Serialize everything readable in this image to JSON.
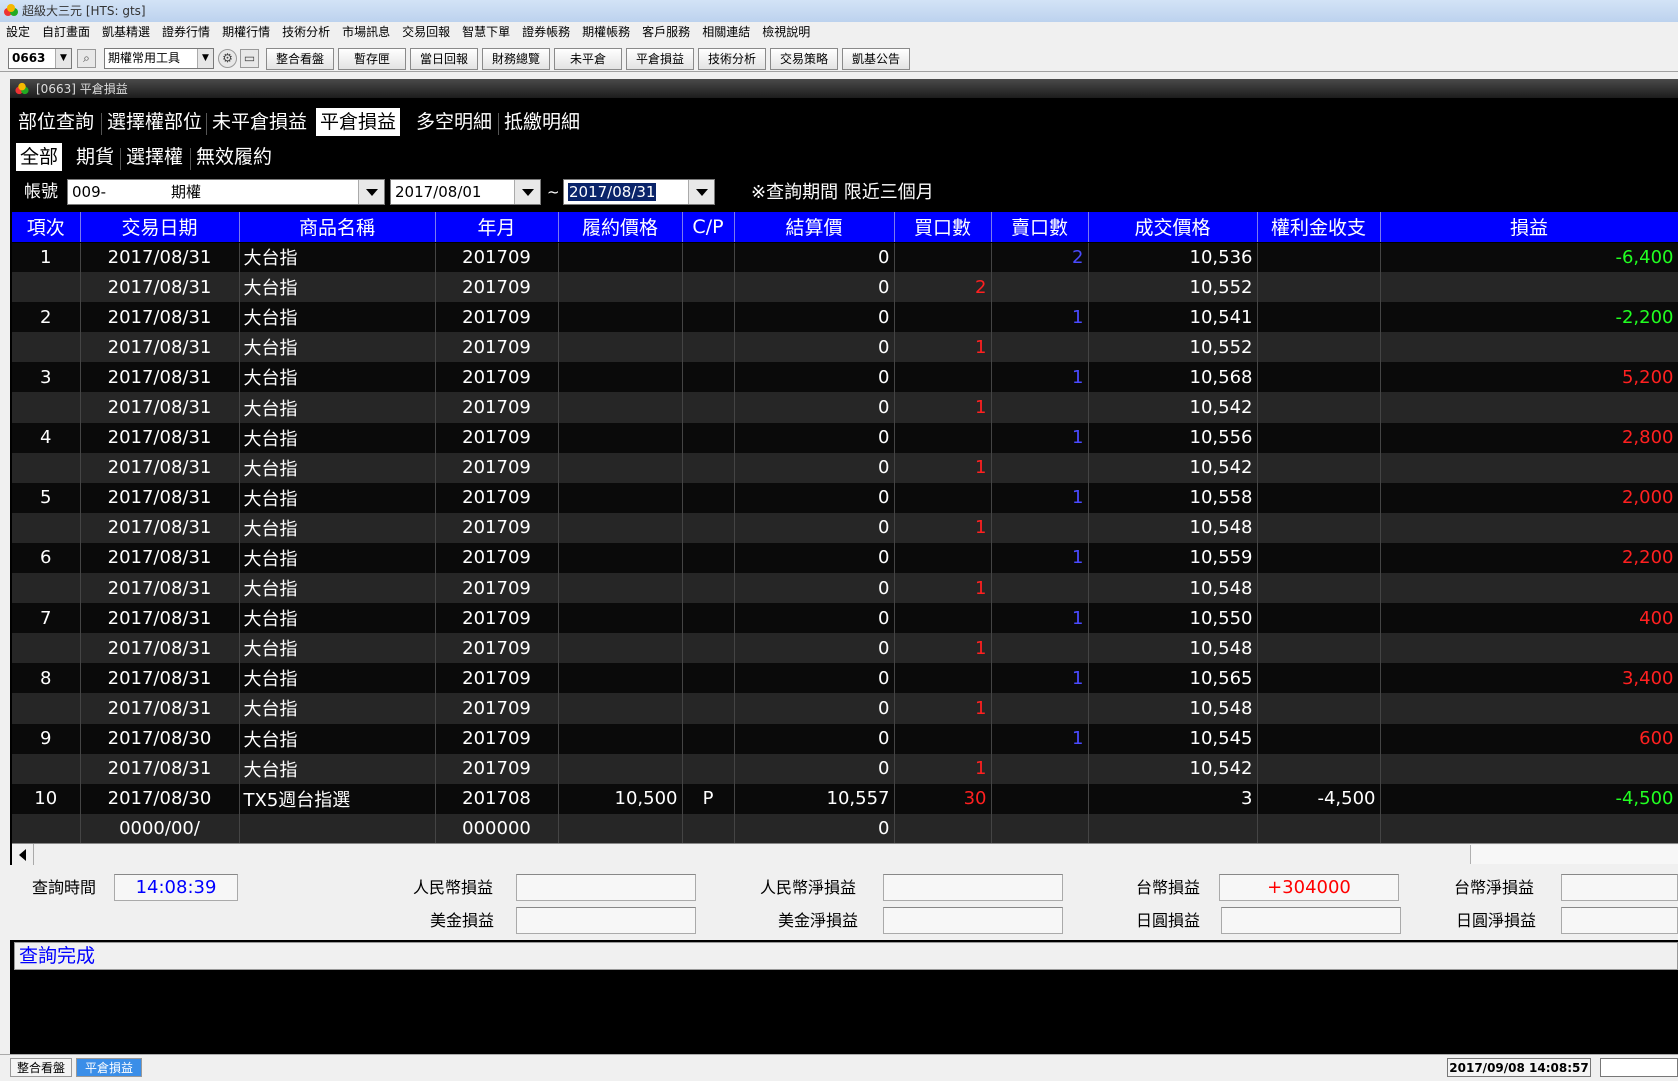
{
  "window": {
    "title": "超級大三元 [HTS: gts]"
  },
  "menu": [
    "設定",
    "自訂畫面",
    "凱基精選",
    "證券行情",
    "期權行情",
    "技術分析",
    "市場訊息",
    "交易回報",
    "智慧下單",
    "證券帳務",
    "期權帳務",
    "客戶服務",
    "相關連結",
    "檢視說明"
  ],
  "toolbar": {
    "code_value": "0663",
    "tool_select": "期權常用工具",
    "buttons": [
      "整合看盤",
      "暫存匣",
      "當日回報",
      "財務總覽",
      "未平倉",
      "平倉損益",
      "技術分析",
      "交易策略",
      "凱基公告"
    ]
  },
  "subwindow": {
    "title": "[0663] 平倉損益"
  },
  "tabs": [
    "部位查詢",
    "選擇權部位",
    "未平倉損益",
    "平倉損益",
    "多空明細",
    "抵繳明細"
  ],
  "subtabs": [
    "全部",
    "期貨",
    "選擇權",
    "無效履約"
  ],
  "filters": {
    "account_label": "帳號",
    "account_value": "009-",
    "account_name": "期權",
    "date_from": "2017/08/01",
    "tilde": "~",
    "date_to": "2017/08/31",
    "note": "※查詢期間 限近三個月"
  },
  "table": {
    "headers": [
      "項次",
      "交易日期",
      "商品名稱",
      "年月",
      "履約價格",
      "C/P",
      "結算價",
      "買口數",
      "賣口數",
      "成交價格",
      "權利金收支",
      "損益"
    ],
    "rows": [
      {
        "no": "1",
        "date": "2017/08/31",
        "name": "大台指",
        "ym": "201709",
        "strike": "",
        "cp": "",
        "settle": "0",
        "buy": "",
        "sell": "2",
        "price": "10,536",
        "premium": "",
        "pl": "-6,400",
        "plc": "green"
      },
      {
        "no": "",
        "date": "2017/08/31",
        "name": "大台指",
        "ym": "201709",
        "strike": "",
        "cp": "",
        "settle": "0",
        "buy": "2",
        "sell": "",
        "price": "10,552",
        "premium": "",
        "pl": "",
        "plc": ""
      },
      {
        "no": "2",
        "date": "2017/08/31",
        "name": "大台指",
        "ym": "201709",
        "strike": "",
        "cp": "",
        "settle": "0",
        "buy": "",
        "sell": "1",
        "price": "10,541",
        "premium": "",
        "pl": "-2,200",
        "plc": "green"
      },
      {
        "no": "",
        "date": "2017/08/31",
        "name": "大台指",
        "ym": "201709",
        "strike": "",
        "cp": "",
        "settle": "0",
        "buy": "1",
        "sell": "",
        "price": "10,552",
        "premium": "",
        "pl": "",
        "plc": ""
      },
      {
        "no": "3",
        "date": "2017/08/31",
        "name": "大台指",
        "ym": "201709",
        "strike": "",
        "cp": "",
        "settle": "0",
        "buy": "",
        "sell": "1",
        "price": "10,568",
        "premium": "",
        "pl": "5,200",
        "plc": "red"
      },
      {
        "no": "",
        "date": "2017/08/31",
        "name": "大台指",
        "ym": "201709",
        "strike": "",
        "cp": "",
        "settle": "0",
        "buy": "1",
        "sell": "",
        "price": "10,542",
        "premium": "",
        "pl": "",
        "plc": ""
      },
      {
        "no": "4",
        "date": "2017/08/31",
        "name": "大台指",
        "ym": "201709",
        "strike": "",
        "cp": "",
        "settle": "0",
        "buy": "",
        "sell": "1",
        "price": "10,556",
        "premium": "",
        "pl": "2,800",
        "plc": "red"
      },
      {
        "no": "",
        "date": "2017/08/31",
        "name": "大台指",
        "ym": "201709",
        "strike": "",
        "cp": "",
        "settle": "0",
        "buy": "1",
        "sell": "",
        "price": "10,542",
        "premium": "",
        "pl": "",
        "plc": ""
      },
      {
        "no": "5",
        "date": "2017/08/31",
        "name": "大台指",
        "ym": "201709",
        "strike": "",
        "cp": "",
        "settle": "0",
        "buy": "",
        "sell": "1",
        "price": "10,558",
        "premium": "",
        "pl": "2,000",
        "plc": "red"
      },
      {
        "no": "",
        "date": "2017/08/31",
        "name": "大台指",
        "ym": "201709",
        "strike": "",
        "cp": "",
        "settle": "0",
        "buy": "1",
        "sell": "",
        "price": "10,548",
        "premium": "",
        "pl": "",
        "plc": ""
      },
      {
        "no": "6",
        "date": "2017/08/31",
        "name": "大台指",
        "ym": "201709",
        "strike": "",
        "cp": "",
        "settle": "0",
        "buy": "",
        "sell": "1",
        "price": "10,559",
        "premium": "",
        "pl": "2,200",
        "plc": "red"
      },
      {
        "no": "",
        "date": "2017/08/31",
        "name": "大台指",
        "ym": "201709",
        "strike": "",
        "cp": "",
        "settle": "0",
        "buy": "1",
        "sell": "",
        "price": "10,548",
        "premium": "",
        "pl": "",
        "plc": ""
      },
      {
        "no": "7",
        "date": "2017/08/31",
        "name": "大台指",
        "ym": "201709",
        "strike": "",
        "cp": "",
        "settle": "0",
        "buy": "",
        "sell": "1",
        "price": "10,550",
        "premium": "",
        "pl": "400",
        "plc": "red"
      },
      {
        "no": "",
        "date": "2017/08/31",
        "name": "大台指",
        "ym": "201709",
        "strike": "",
        "cp": "",
        "settle": "0",
        "buy": "1",
        "sell": "",
        "price": "10,548",
        "premium": "",
        "pl": "",
        "plc": ""
      },
      {
        "no": "8",
        "date": "2017/08/31",
        "name": "大台指",
        "ym": "201709",
        "strike": "",
        "cp": "",
        "settle": "0",
        "buy": "",
        "sell": "1",
        "price": "10,565",
        "premium": "",
        "pl": "3,400",
        "plc": "red"
      },
      {
        "no": "",
        "date": "2017/08/31",
        "name": "大台指",
        "ym": "201709",
        "strike": "",
        "cp": "",
        "settle": "0",
        "buy": "1",
        "sell": "",
        "price": "10,548",
        "premium": "",
        "pl": "",
        "plc": ""
      },
      {
        "no": "9",
        "date": "2017/08/30",
        "name": "大台指",
        "ym": "201709",
        "strike": "",
        "cp": "",
        "settle": "0",
        "buy": "",
        "sell": "1",
        "price": "10,545",
        "premium": "",
        "pl": "600",
        "plc": "red"
      },
      {
        "no": "",
        "date": "2017/08/31",
        "name": "大台指",
        "ym": "201709",
        "strike": "",
        "cp": "",
        "settle": "0",
        "buy": "1",
        "sell": "",
        "price": "10,542",
        "premium": "",
        "pl": "",
        "plc": ""
      },
      {
        "no": "10",
        "date": "2017/08/30",
        "name": "TX5週台指選",
        "ym": "201708",
        "strike": "10,500",
        "cp": "P",
        "settle": "10,557",
        "buy": "30",
        "sell": "",
        "price": "3",
        "premium": "-4,500",
        "pl": "-4,500",
        "plc": "green"
      },
      {
        "no": "",
        "date": "0000/00/",
        "name": "",
        "ym": "000000",
        "strike": "",
        "cp": "",
        "settle": "0",
        "buy": "",
        "sell": "",
        "price": "",
        "premium": "",
        "pl": "",
        "plc": ""
      }
    ]
  },
  "summary": {
    "query_time_label": "查詢時間",
    "query_time": "14:08:39",
    "rmb_pl_label": "人民幣損益",
    "rmb_pl": "",
    "rmb_net_label": "人民幣淨損益",
    "rmb_net": "",
    "twd_pl_label": "台幣損益",
    "twd_pl": "+304000",
    "twd_net_label": "台幣淨損益",
    "usd_pl_label": "美金損益",
    "usd_pl": "",
    "usd_net_label": "美金淨損益",
    "usd_net": "",
    "jpy_pl_label": "日圓損益",
    "jpy_pl": "",
    "jpy_net_label": "日圓淨損益"
  },
  "status": "查詢完成",
  "taskbar": {
    "items": [
      "整合看盤",
      "平倉損益"
    ],
    "clock": "2017/09/08 14:08:57"
  },
  "colors": {
    "header_blue": "#0000ff",
    "profit_red": "#ff2020",
    "loss_green": "#21ff21",
    "qty_blue": "#4a4aff"
  },
  "icons": [
    "app-logo-icon",
    "search-icon",
    "gear-icon",
    "window-add-icon",
    "dropdown-arrow-icon",
    "scroll-left-icon"
  ]
}
